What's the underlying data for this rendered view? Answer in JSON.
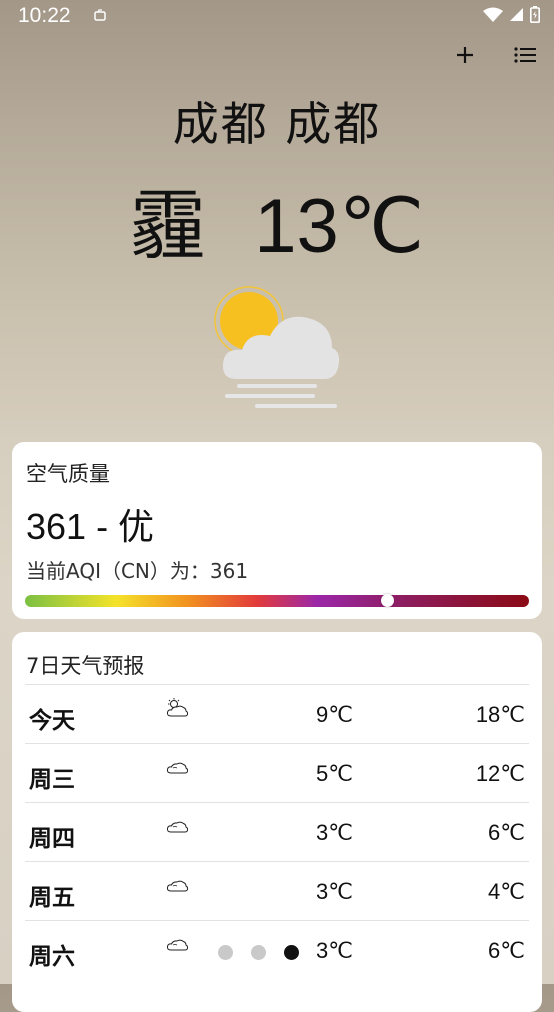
{
  "status_bar": {
    "time": "10:22",
    "icons": [
      "notification-icon",
      "wifi-icon",
      "signal-icon",
      "battery-icon"
    ]
  },
  "toolbar": {
    "add_icon": "plus-icon",
    "menu_icon": "list-icon"
  },
  "location": {
    "city": "成都 成都"
  },
  "current": {
    "condition": "霾",
    "temperature": "13℃",
    "icon": "partly-cloudy-haze-icon"
  },
  "air_quality": {
    "title": "空气质量",
    "value_text": "361 - 优",
    "description": "当前AQI（CN）为：361",
    "gauge_level": 0.72
  },
  "forecast": {
    "title": "7日天气预报",
    "days": [
      {
        "day": "今天",
        "icon": "partly-cloudy-icon",
        "low": "9℃",
        "high": "18℃"
      },
      {
        "day": "周三",
        "icon": "cloudy-icon",
        "low": "5℃",
        "high": "12℃"
      },
      {
        "day": "周四",
        "icon": "cloudy-icon",
        "low": "3℃",
        "high": "6℃"
      },
      {
        "day": "周五",
        "icon": "cloudy-icon",
        "low": "3℃",
        "high": "4℃"
      },
      {
        "day": "周六",
        "icon": "cloudy-icon",
        "low": "3℃",
        "high": "6℃"
      }
    ]
  },
  "pager": {
    "count": 3,
    "active_index": 2
  }
}
